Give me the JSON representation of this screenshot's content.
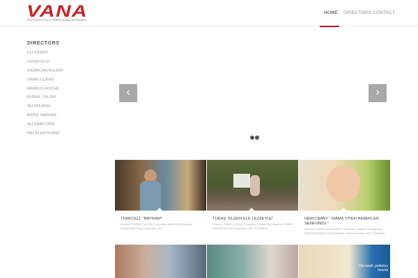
{
  "header": {
    "logo": "VANA",
    "tagline": "FILM PRODUCTION COMPANY BASED IN ISTANBUL",
    "nav": [
      {
        "label": "HOME",
        "active": true
      },
      {
        "label": "DIRECTORS"
      },
      {
        "label": "CONTACT"
      }
    ],
    "accent": "#a0262b"
  },
  "sidebar": {
    "title": "DIRECTORS",
    "items": [
      "ELİ KASAVİ",
      "GİZEM ELÇİ",
      "KADİRCAN KULBAY",
      "SİNAN UÇKAN",
      "MARKUS ROCHE",
      "BURAK ÇALDIR",
      "ALİ ATA AKEL",
      "BARIŞ SARHAN",
      "ALİ KAAN DİNÇ",
      "MELİH ERYILMAZ"
    ]
  },
  "slider": {
    "prev": "‹",
    "next": "›",
    "slides": 2
  },
  "works": [
    {
      "title": "TURKCELL \"BAYRAM\"",
      "body": "Director: BURAK ÇALDIR Production:VANA FILM Agency: PAPAGENO Post Production: IPO"
    },
    {
      "title": "TUKAŞ \"ELDEN ELE LEZZETLE\"",
      "body": "Director: SİNAN UÇKAN Production: VANA FILM Agency: VIVAKI CREATIVE Post Production: ART ISTANBUL"
    },
    {
      "title": "HERO BABY \" MAMA YİYEN BEBEKLER SENFONİSİ \"",
      "body": "Director: KADİRCAN KULBAY Production: VANA FILM Agency: SAATCHI&SAATCHI ISTANBUL Post Production: ART ISTANBUL"
    }
  ],
  "row2_overlay": "Dizi keyfi, patlamış mısırla"
}
